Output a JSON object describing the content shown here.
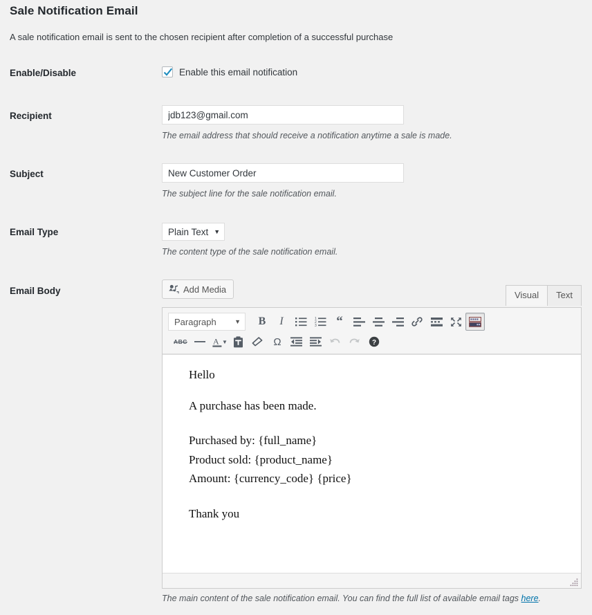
{
  "header": {
    "title": "Sale Notification Email",
    "description": "A sale notification email is sent to the chosen recipient after completion of a successful purchase"
  },
  "fields": {
    "enable": {
      "label": "Enable/Disable",
      "checkbox_label": "Enable this email notification",
      "checked": true
    },
    "recipient": {
      "label": "Recipient",
      "value": "jdb123@gmail.com",
      "placeholder": "",
      "help": "The email address that should receive a notification anytime a sale is made."
    },
    "subject": {
      "label": "Subject",
      "value": "New Customer Order",
      "placeholder": "",
      "help": "The subject line for the sale notification email."
    },
    "email_type": {
      "label": "Email Type",
      "value": "Plain Text",
      "caret": "▼",
      "help": "The content type of the sale notification email."
    },
    "email_body": {
      "label": "Email Body",
      "help_prefix": "The main content of the sale notification email. You can find the full list of available email tags ",
      "help_link": "here",
      "help_suffix": "."
    }
  },
  "editor": {
    "add_media_label": "Add Media",
    "tabs": [
      {
        "label": "Visual",
        "active": true
      },
      {
        "label": "Text",
        "active": false
      }
    ],
    "format_select": {
      "value": "Paragraph",
      "caret": "▼"
    },
    "toolbar_row1": [
      {
        "name": "bold-icon",
        "title": "Bold"
      },
      {
        "name": "italic-icon",
        "title": "Italic"
      },
      {
        "name": "bulleted-list-icon",
        "title": "Bulleted list"
      },
      {
        "name": "numbered-list-icon",
        "title": "Numbered list"
      },
      {
        "name": "blockquote-icon",
        "title": "Blockquote"
      },
      {
        "name": "align-left-icon",
        "title": "Align left"
      },
      {
        "name": "align-center-icon",
        "title": "Align center"
      },
      {
        "name": "align-right-icon",
        "title": "Align right"
      },
      {
        "name": "link-icon",
        "title": "Insert/edit link"
      },
      {
        "name": "read-more-icon",
        "title": "Insert Read More tag"
      },
      {
        "name": "fullscreen-icon",
        "title": "Distraction-free writing mode"
      },
      {
        "name": "kitchen-sink-icon",
        "title": "Toolbar Toggle",
        "active": true
      }
    ],
    "toolbar_row2": [
      {
        "name": "strikethrough-icon",
        "title": "Strikethrough",
        "glyph": "ABC"
      },
      {
        "name": "horizontal-rule-icon",
        "title": "Horizontal line"
      },
      {
        "name": "text-color-icon",
        "title": "Text color"
      },
      {
        "name": "text-color-caret-icon",
        "title": "Text color options",
        "glyph": "▼"
      },
      {
        "name": "paste-as-text-icon",
        "title": "Paste as text"
      },
      {
        "name": "clear-formatting-icon",
        "title": "Clear formatting"
      },
      {
        "name": "special-character-icon",
        "title": "Special character",
        "glyph": "Ω"
      },
      {
        "name": "outdent-icon",
        "title": "Decrease indent"
      },
      {
        "name": "indent-icon",
        "title": "Increase indent"
      },
      {
        "name": "undo-icon",
        "title": "Undo",
        "disabled": true
      },
      {
        "name": "redo-icon",
        "title": "Redo",
        "disabled": true
      },
      {
        "name": "help-icon",
        "title": "Keyboard Shortcuts"
      }
    ],
    "body_paragraphs": [
      "Hello",
      "A purchase has been made.",
      "Purchased by: {full_name}",
      "Product sold: {product_name}",
      "Amount: {currency_code} {price}",
      "Thank you"
    ]
  },
  "colors": {
    "page_background": "#f1f1f1",
    "label_text": "#23282d",
    "help_text": "#52575c",
    "link": "#0073aa",
    "checkbox_check": "#1e8cbe",
    "icon": "#555d66",
    "input_border": "#dddddd",
    "editor_border": "#cccccc"
  }
}
